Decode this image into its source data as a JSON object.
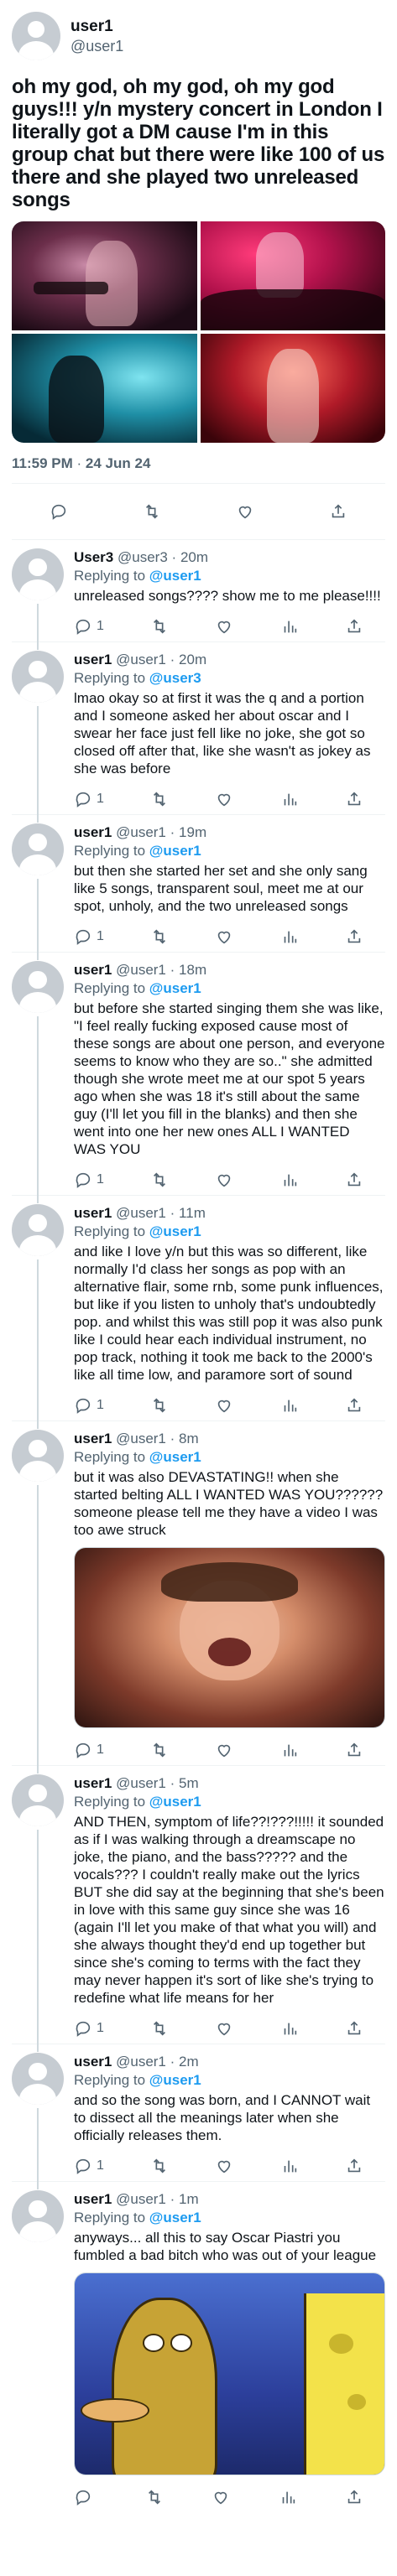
{
  "main_tweet": {
    "name": "user1",
    "handle": "@user1",
    "text": "oh my god, oh my god, oh my god guys!!! y/n mystery concert in London I literally got a DM cause I'm in this group chat but there were like 100 of us there and she played two unreleased songs",
    "time": "11:59 PM",
    "date": "24 Jun 24",
    "separator": "·",
    "photos": [
      "concert-photo-1",
      "concert-photo-2",
      "concert-photo-3",
      "concert-photo-4"
    ],
    "icons": [
      "reply-icon",
      "retweet-icon",
      "like-icon",
      "share-icon"
    ]
  },
  "replies": [
    {
      "name": "User3",
      "handle": "@user3",
      "time": "20m",
      "replying_label": "Replying to",
      "replying_to": "@user1",
      "text": "unreleased songs???? show me to me please!!!!",
      "reply_count": "1"
    },
    {
      "name": "user1",
      "handle": "@user1",
      "time": "20m",
      "replying_label": "Replying to",
      "replying_to": "@user3",
      "text": "lmao okay so at first it was the q and a portion and I someone asked her about oscar and I swear her face just fell like no joke, she got so closed off after that, like she wasn't as jokey as she was before",
      "reply_count": "1"
    },
    {
      "name": "user1",
      "handle": "@user1",
      "time": "19m",
      "replying_label": "Replying to",
      "replying_to": "@user1",
      "text": "but then she started her set and she only sang like 5 songs, transparent soul, meet me at our spot, unholy, and the two unreleased songs",
      "reply_count": "1"
    },
    {
      "name": "user1",
      "handle": "@user1",
      "time": "18m",
      "replying_label": "Replying to",
      "replying_to": "@user1",
      "text": "but before she started singing them she was like, \"I feel really fucking exposed cause most of these songs are about one person, and everyone seems to know who they are so..\" she admitted though she wrote meet me at our spot 5 years ago when she was 18 it's still about the same guy (I'll let you fill in the blanks) and then she went into one her new ones ALL I WANTED WAS YOU",
      "reply_count": "1"
    },
    {
      "name": "user1",
      "handle": "@user1",
      "time": "11m",
      "replying_label": "Replying to",
      "replying_to": "@user1",
      "text": "and like I love y/n but this was so different, like normally I'd class her songs as pop with an alternative flair, some rnb, some punk influences, but like if you listen to unholy that's undoubtedly pop. and whilst this was still pop it was also punk like I could hear each individual instrument, no pop track, nothing it took me back to the 2000's like all time low, and paramore sort of sound",
      "reply_count": "1"
    },
    {
      "name": "user1",
      "handle": "@user1",
      "time": "8m",
      "replying_label": "Replying to",
      "replying_to": "@user1",
      "text": "but it was also DEVASTATING!! when she started belting ALL I WANTED WAS YOU?????? someone please tell me they have a video I was too awe struck",
      "reply_count": "1",
      "media": "crying-reaction-image"
    },
    {
      "name": "user1",
      "handle": "@user1",
      "time": "5m",
      "replying_label": "Replying to",
      "replying_to": "@user1",
      "text": "AND THEN, symptom of life??!???!!!!! it sounded as if I was walking through a dreamscape no joke, the piano, and the bass????? and the vocals??? I couldn't really make out the lyrics BUT she did say at the beginning that she's been in love with this same guy since she was 16 (again I'll let you make of that what you will) and she always thought they'd end up together but since she's coming to terms with the fact they may never happen it's sort of like she's trying to redefine what life means for her",
      "reply_count": "1"
    },
    {
      "name": "user1",
      "handle": "@user1",
      "time": "2m",
      "replying_label": "Replying to",
      "replying_to": "@user1",
      "text": "and so the song was born, and I CANNOT wait to dissect all the meanings later when she officially releases them.",
      "reply_count": "1"
    },
    {
      "name": "user1",
      "handle": "@user1",
      "time": "1m",
      "replying_label": "Replying to",
      "replying_to": "@user1",
      "text": "anyways... all this to say Oscar Piastri you fumbled a bad bitch who was out of your league",
      "reply_count": "",
      "media": "spongebob-meme-image"
    }
  ],
  "colors": {
    "text": "#0f1419",
    "secondary": "#536471",
    "mention": "#1d9bf0",
    "border": "#eff3f4",
    "thread_line": "#cfd9de",
    "avatar": "#c6ccd2"
  }
}
